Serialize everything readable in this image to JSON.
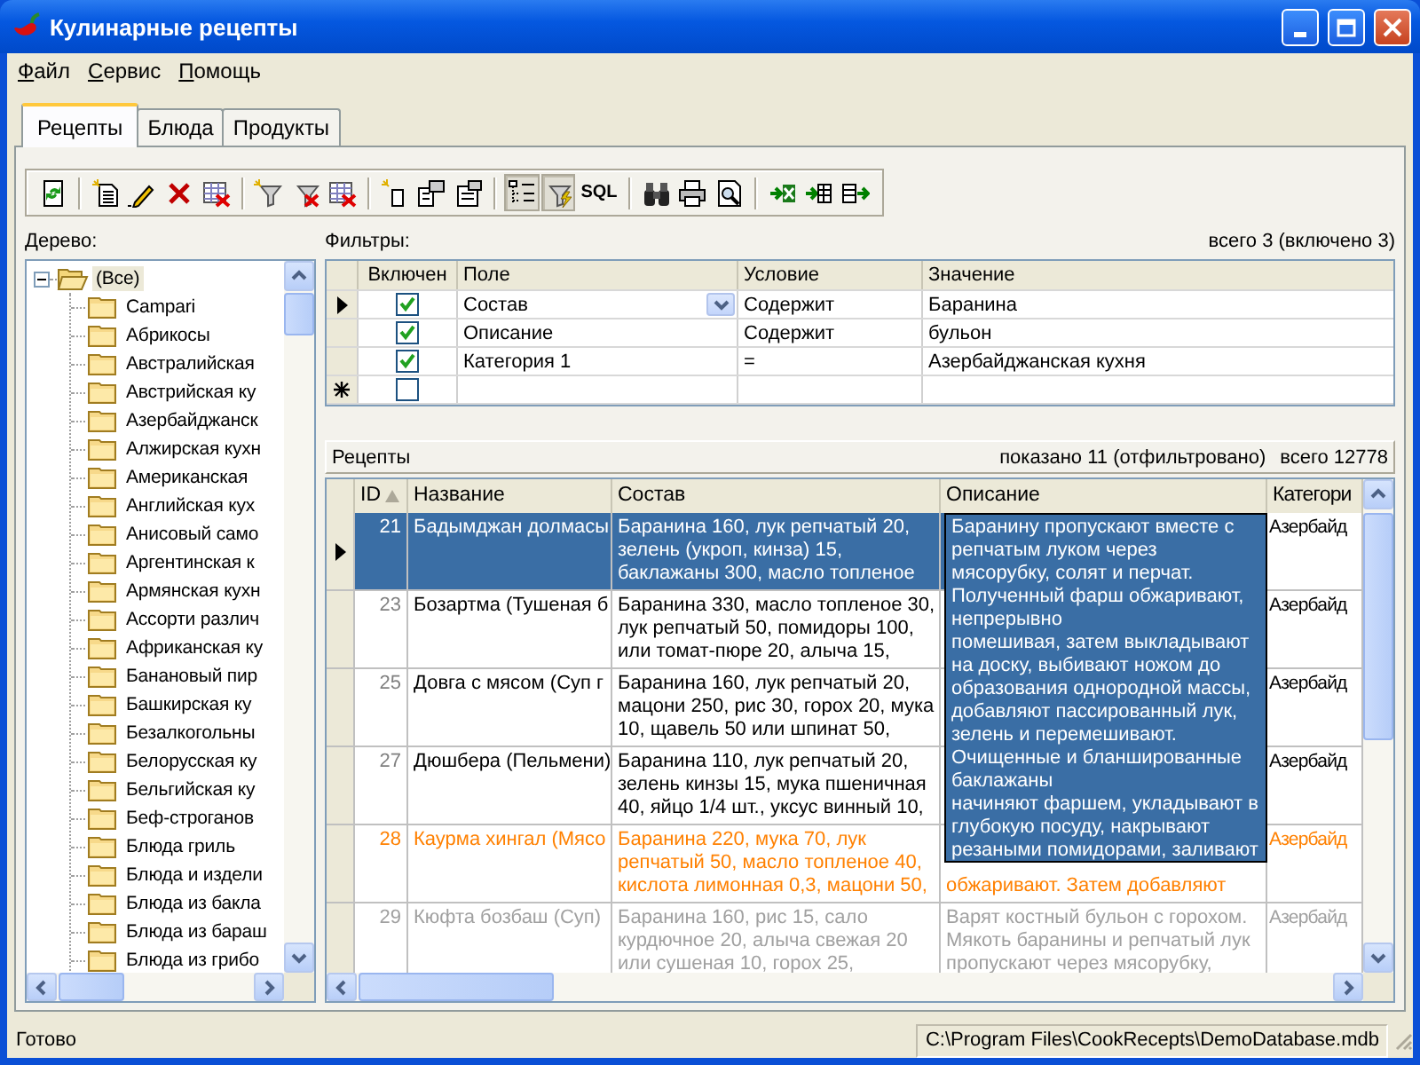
{
  "window": {
    "title": "Кулинарные рецепты"
  },
  "menu": [
    "Файл",
    "Сервис",
    "Помощь"
  ],
  "tabs": [
    {
      "label": "Рецепты",
      "selected": true
    },
    {
      "label": "Блюда",
      "selected": false
    },
    {
      "label": "Продукты",
      "selected": false
    }
  ],
  "toolbar": {
    "groups": [
      [
        {
          "pressed": false
        }
      ],
      [
        {
          "pressed": false
        },
        {
          "pressed": false
        },
        {
          "pressed": false
        },
        {
          "pressed": false
        }
      ],
      [
        {
          "pressed": false
        },
        {
          "pressed": false
        },
        {
          "pressed": false
        }
      ],
      [
        {
          "pressed": false
        },
        {
          "pressed": false
        },
        {
          "pressed": false
        }
      ],
      [
        {
          "pressed": true
        },
        {
          "pressed": true
        },
        {
          "pressed": false,
          "label": "SQL"
        }
      ],
      [
        {
          "pressed": false
        },
        {
          "pressed": false
        },
        {
          "pressed": false
        }
      ],
      [
        {
          "pressed": false
        },
        {
          "pressed": false
        },
        {
          "pressed": false
        }
      ]
    ]
  },
  "tree": {
    "label": "Дерево:",
    "root": {
      "label": "(Все)",
      "expanded": true,
      "selected": true,
      "children": [
        {
          "label": "Campari",
          "selected": false
        },
        {
          "label": "Абрикосы",
          "selected": false
        },
        {
          "label": "Австралийская",
          "selected": false
        },
        {
          "label": "Австрийская ку",
          "selected": false
        },
        {
          "label": "Азербайджанск",
          "selected": false
        },
        {
          "label": "Алжирская кухн",
          "selected": false
        },
        {
          "label": "Американская",
          "selected": false
        },
        {
          "label": "Английская кух",
          "selected": false
        },
        {
          "label": "Анисовый само",
          "selected": false
        },
        {
          "label": "Аргентинская к",
          "selected": false
        },
        {
          "label": "Армянская кухн",
          "selected": false
        },
        {
          "label": "Ассорти различ",
          "selected": false
        },
        {
          "label": "Африканская ку",
          "selected": false
        },
        {
          "label": "Банановый пир",
          "selected": false
        },
        {
          "label": "Башкирская ку",
          "selected": false
        },
        {
          "label": "Безалкогольны",
          "selected": false
        },
        {
          "label": "Белорусская ку",
          "selected": false
        },
        {
          "label": "Бельгийская ку",
          "selected": false
        },
        {
          "label": "Беф-строганов",
          "selected": false
        },
        {
          "label": "Блюда гриль",
          "selected": false
        },
        {
          "label": "Блюда и издели",
          "selected": false
        },
        {
          "label": "Блюда из бакла",
          "selected": false
        },
        {
          "label": "Блюда из бараш",
          "selected": false
        },
        {
          "label": "Блюда из грибо",
          "selected": false
        }
      ]
    }
  },
  "filters": {
    "label": "Фильтры:",
    "summary": "всего 3 (включено 3)",
    "columns": [
      "Включен",
      "Поле",
      "Условие",
      "Значение"
    ],
    "rows": [
      {
        "current": true,
        "enabled": true,
        "field": "Состав",
        "dropdown": true,
        "condition": "Содержит",
        "value": "Баранина"
      },
      {
        "current": false,
        "enabled": true,
        "field": "Описание",
        "dropdown": false,
        "condition": "Содержит",
        "value": "бульон"
      },
      {
        "current": false,
        "enabled": true,
        "field": "Категория 1",
        "dropdown": false,
        "condition": "=",
        "value": "Азербайджанская кухня"
      }
    ],
    "new_row": {
      "enabled": false
    }
  },
  "recipes": {
    "label": "Рецепты",
    "shown": "показано 11 (отфильтровано)",
    "total": "всего 12778",
    "columns": [
      {
        "label": "ID",
        "sorted": true
      },
      {
        "label": "Название",
        "sorted": false
      },
      {
        "label": "Состав",
        "sorted": false
      },
      {
        "label": "Описание",
        "sorted": false
      },
      {
        "label": "Категори",
        "sorted": false
      }
    ],
    "rows": [
      {
        "current": true,
        "selected": true,
        "kind": "normal",
        "id": "21",
        "name": "Бадымджан долмасы",
        "composition": "Баранина 160, лук репчатый 20,\nзелень (укроп, кинза) 15,\nбаклажаны 300, масло топленое",
        "category": "Азербайд"
      },
      {
        "current": false,
        "selected": false,
        "kind": "normal",
        "id": "23",
        "name": "Бозартма (Тушеная б",
        "composition": "Баранина 330, масло топленое 30,\nлук репчатый 50, помидоры 100,\nили томат-пюре 20, алыча 15,",
        "category": "Азербайд"
      },
      {
        "current": false,
        "selected": false,
        "kind": "normal",
        "id": "25",
        "name": "Довга с мясом (Суп г",
        "composition": "Баранина 160, лук репчатый 20,\nмацони 250, рис 30, горох 20, мука\n10, щавель 50 или шпинат 50,",
        "category": "Азербайд"
      },
      {
        "current": false,
        "selected": false,
        "kind": "normal",
        "id": "27",
        "name": "Дюшбера (Пельмени)",
        "composition": "Баранина 110, лук репчатый 20,\nзелень кинзы 15, мука пшеничная\n40, яйцо 1/4 шт., уксус винный 10,",
        "category": "Азербайд"
      },
      {
        "current": false,
        "selected": false,
        "kind": "highlighted",
        "id": "28",
        "name": "Каурма хингал (Мясо",
        "composition": "Баранина 220, мука 70, лук\nрепчатый 50, масло топленое 40,\nкислота лимонная 0,3, мацони 50,",
        "description": "обжаривают. Затем добавляют",
        "category": "Азербайд"
      },
      {
        "current": false,
        "selected": false,
        "kind": "inactive",
        "id": "29",
        "name": "Кюфта бозбаш (Суп)",
        "composition": "Баранина 160, рис 15, сало\nкурдючное 20, алыча свежая 20\nили сушеная 10, горох 25,",
        "description": "Варят костный бульон с горохом.\nМякоть баранины и репчатый лук\nпропускают через мясорубку,",
        "category": "Азербайд"
      }
    ],
    "editor": {
      "text": "Баранину пропускают вместе с\nрепчатым луком через\nмясорубку, солят и перчат.\nПолученный фарш обжаривают,\nнепрерывно\nпомешивая, затем выкладывают\nна доску, выбивают ножом до\nобразования однородной массы,\nдобавляют пассированный лук,\nзелень и перемешивают.\nОчищенные и бланшированные\nбаклажаны\nначиняют фаршем, укладывают в\nглубокую посуду, накрывают\nрезаными помидорами, заливают"
    }
  },
  "status_bar": {
    "message": "Готово",
    "path": "C:\\Program Files\\CookRecepts\\DemoDatabase.mdb"
  }
}
